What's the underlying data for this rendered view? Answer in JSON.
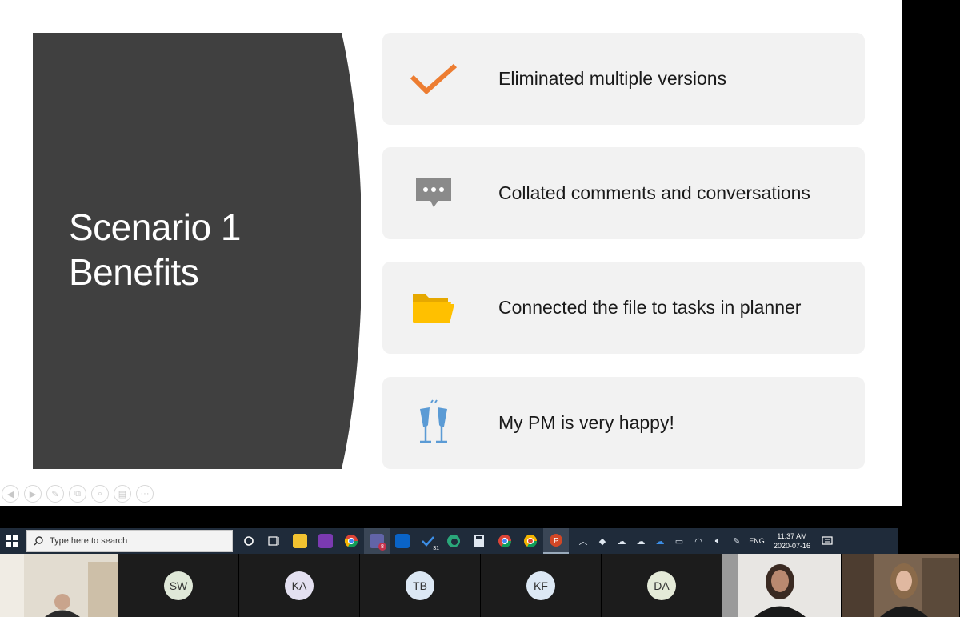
{
  "slide": {
    "title_line1": "Scenario 1",
    "title_line2": "Benefits",
    "cards": [
      {
        "icon": "checkmark-icon",
        "text": "Eliminated multiple versions"
      },
      {
        "icon": "chat-bubble-icon",
        "text": "Collated comments and conversations"
      },
      {
        "icon": "folder-icon",
        "text": "Connected the file to tasks in planner"
      },
      {
        "icon": "champagne-toast-icon",
        "text": "My PM is very happy!"
      }
    ],
    "controls": [
      "◀",
      "▶",
      "✎",
      "⧉",
      "⌕",
      "▤",
      "···"
    ]
  },
  "taskbar": {
    "search_placeholder": "Type here to search",
    "outlook_badge": "31",
    "teams_badge": "8",
    "language": "ENG",
    "time": "11:37 AM",
    "date": "2020-07-16"
  },
  "participants": [
    {
      "type": "video",
      "name": "participant-video-1"
    },
    {
      "type": "initials",
      "initials": "SW",
      "color": "#dfe8d8"
    },
    {
      "type": "initials",
      "initials": "KA",
      "color": "#e3e0f0"
    },
    {
      "type": "initials",
      "initials": "TB",
      "color": "#dce8f4"
    },
    {
      "type": "initials",
      "initials": "KF",
      "color": "#dce8f4"
    },
    {
      "type": "initials",
      "initials": "DA",
      "color": "#e4ead8"
    },
    {
      "type": "video",
      "name": "participant-video-2"
    },
    {
      "type": "video",
      "name": "participant-video-3"
    }
  ],
  "colors": {
    "title_panel": "#404040",
    "check": "#ed7d31",
    "chat": "#808080",
    "folder": "#ffc000",
    "glasses": "#5b9bd5",
    "taskbar": "#1f2b3a"
  }
}
